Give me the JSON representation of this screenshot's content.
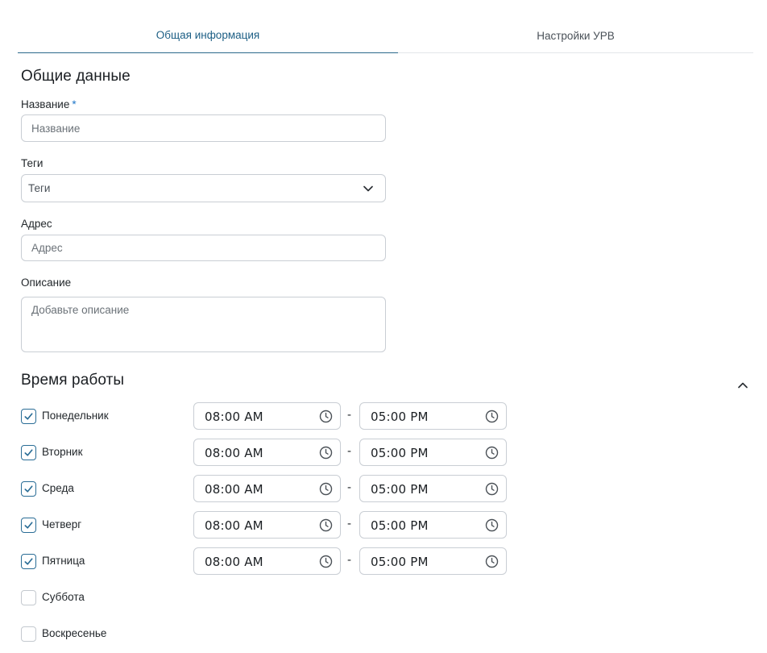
{
  "tabs": [
    {
      "label": "Общая информация",
      "active": true
    },
    {
      "label": "Настройки УРВ",
      "active": false
    }
  ],
  "general": {
    "title": "Общие данные",
    "name": {
      "label": "Название",
      "required_mark": "*",
      "placeholder": "Название",
      "value": ""
    },
    "tags": {
      "label": "Теги",
      "selected": "Теги"
    },
    "address": {
      "label": "Адрес",
      "placeholder": "Адрес",
      "value": ""
    },
    "description": {
      "label": "Описание",
      "placeholder": "Добавьте описание",
      "value": ""
    }
  },
  "schedule": {
    "title": "Время работы",
    "separator": "-",
    "days": [
      {
        "name": "Понедельник",
        "checked": true,
        "start": "08:00 AM",
        "end": "05:00 PM"
      },
      {
        "name": "Вторник",
        "checked": true,
        "start": "08:00 AM",
        "end": "05:00 PM"
      },
      {
        "name": "Среда",
        "checked": true,
        "start": "08:00 AM",
        "end": "05:00 PM"
      },
      {
        "name": "Четверг",
        "checked": true,
        "start": "08:00 AM",
        "end": "05:00 PM"
      },
      {
        "name": "Пятница",
        "checked": true,
        "start": "08:00 AM",
        "end": "05:00 PM"
      },
      {
        "name": "Суббота",
        "checked": false
      },
      {
        "name": "Воскресенье",
        "checked": false
      }
    ]
  },
  "colors": {
    "accent": "#2a6d96",
    "active_tab_text": "#1d5f85",
    "border": "#c9ced4",
    "required": "#1e76c8"
  },
  "icons": {
    "select": "chevron-down-icon",
    "collapse": "chevron-up-icon",
    "time": "clock-icon",
    "check": "check-icon"
  }
}
